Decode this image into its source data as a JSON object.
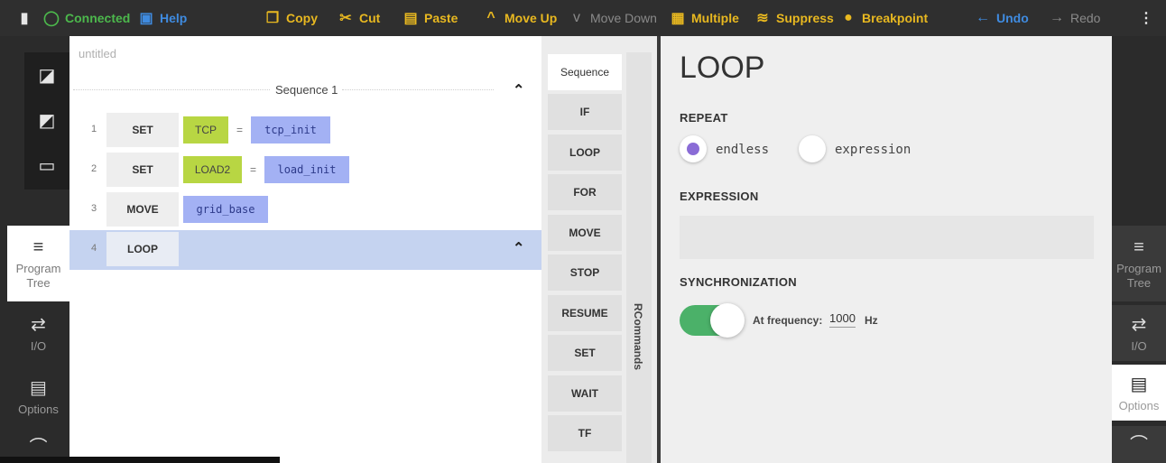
{
  "toolbar": {
    "connected": "Connected",
    "help": "Help",
    "copy": "Copy",
    "cut": "Cut",
    "paste": "Paste",
    "move_up": "Move Up",
    "move_down": "Move Down",
    "multiple": "Multiple",
    "suppress": "Suppress",
    "breakpoint": "Breakpoint",
    "undo": "Undo",
    "redo": "Redo"
  },
  "left_nav": {
    "program_tree": "Program\nTree",
    "io": "I/O",
    "options": "Options"
  },
  "tree": {
    "title": "untitled",
    "sequence_label": "Sequence 1",
    "rows": [
      {
        "num": "1",
        "cmd": "SET",
        "target": "TCP",
        "eq": "=",
        "value": "tcp_init"
      },
      {
        "num": "2",
        "cmd": "SET",
        "target": "LOAD2",
        "eq": "=",
        "value": "load_init"
      },
      {
        "num": "3",
        "cmd": "MOVE",
        "value": "grid_base"
      },
      {
        "num": "4",
        "cmd": "LOOP"
      }
    ]
  },
  "palette": {
    "items": [
      "Sequence",
      "IF",
      "LOOP",
      "FOR",
      "MOVE",
      "STOP",
      "RESUME",
      "SET",
      "WAIT",
      "TF"
    ],
    "side_label": "RCommands"
  },
  "props": {
    "title": "LOOP",
    "repeat_label": "REPEAT",
    "opt_endless": "endless",
    "opt_expression": "expression",
    "expression_label": "EXPRESSION",
    "expression_value": "",
    "sync_label": "SYNCHRONIZATION",
    "freq_label": "At frequency:",
    "freq_value": "1000",
    "freq_unit": "Hz",
    "sync_enabled": true,
    "repeat_selected": "endless"
  },
  "right_nav": {
    "program_tree": "Program\nTree",
    "io": "I/O",
    "options": "Options"
  },
  "colors": {
    "accent_yellow": "#e8b820",
    "link_blue": "#3f8be0",
    "connected_green": "#4cb84c",
    "chip_green": "#b8d643",
    "chip_blue": "#a3b1f4",
    "selected_row": "#c5d3f0",
    "radio_purple": "#8a6cd6",
    "toggle_green": "#4bb169"
  }
}
